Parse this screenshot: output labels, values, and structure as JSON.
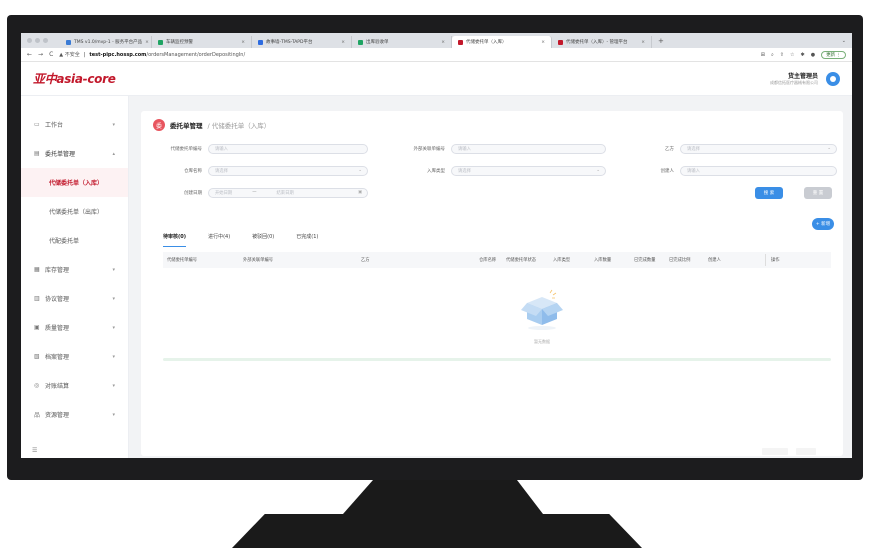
{
  "browser": {
    "tabs": [
      {
        "label": "TMS v1.0/mvp-1 - 服务平台产品",
        "color": "#3a7bd5"
      },
      {
        "label": "车辆监控预警",
        "color": "#1fa463"
      },
      {
        "label": "故事墙-TMS-TAPD平台",
        "color": "#2d6be0"
      },
      {
        "label": "出库验收单",
        "color": "#1fa463"
      },
      {
        "label": "代储委托单（入库）",
        "color": "#c2182b",
        "active": true
      },
      {
        "label": "代储委托单（入库）- 管理平台",
        "color": "#c2182b"
      }
    ],
    "new_tab": "+",
    "more": "⌄",
    "nav": {
      "back": "←",
      "forward": "→",
      "reload": "C"
    },
    "url_warning": "▲ 不安全",
    "url_host": "test-pipc.hossp.com",
    "url_path": "/ordersManagement/orderDepositingIn/",
    "update_label": "更新 ⋮"
  },
  "app": {
    "logo": "亚中asia-core",
    "user_name": "货主管理员",
    "user_org": "成都信拓医疗器械有限公司"
  },
  "sidebar": {
    "items": [
      {
        "icon": "▭",
        "label": "工作台",
        "chev": "▾"
      },
      {
        "icon": "▤",
        "label": "委托单管理",
        "chev": "▴",
        "open": true
      }
    ],
    "sub_items": [
      {
        "label": "代储委托单（入库）",
        "active": true
      },
      {
        "label": "代储委托单（出库）"
      },
      {
        "label": "代配委托单"
      }
    ],
    "more_items": [
      {
        "icon": "▦",
        "label": "库存管理",
        "chev": "▾"
      },
      {
        "icon": "▥",
        "label": "协议管理",
        "chev": "▾"
      },
      {
        "icon": "▣",
        "label": "质量管理",
        "chev": "▾"
      },
      {
        "icon": "▧",
        "label": "档案管理",
        "chev": "▾"
      },
      {
        "icon": "◎",
        "label": "对账结算",
        "chev": "▾"
      },
      {
        "icon": "品",
        "label": "资源管理",
        "chev": "▾"
      }
    ],
    "footer": "☰"
  },
  "page": {
    "badge": "委",
    "title": "委托单管理",
    "crumb": "/ 代储委托单（入库）"
  },
  "filters": {
    "order_no": {
      "label": "代储委托单编号",
      "placeholder": "请输入"
    },
    "external_no": {
      "label": "外部关联单编号",
      "placeholder": "请输入"
    },
    "party_b": {
      "label": "乙方",
      "placeholder": "请选择"
    },
    "warehouse": {
      "label": "仓库名称",
      "placeholder": "请选择"
    },
    "inbound_type": {
      "label": "入库类型",
      "placeholder": "请选择"
    },
    "creator": {
      "label": "创建人",
      "placeholder": "请输入"
    },
    "date_label": "创建日期",
    "date_start": "开始日期",
    "date_sep": "—",
    "date_end": "结束日期",
    "search": "搜 索",
    "reset": "重 置"
  },
  "add_button": "+ 新增",
  "status_tabs": [
    "待审核(0)",
    "进行中(4)",
    "被驳回(0)",
    "已完成(1)"
  ],
  "columns": [
    "代储委托单编号",
    "外部关联单编号",
    "乙方",
    "仓库名称",
    "代储委托单状态",
    "入库类型",
    "入库数量",
    "已完成数量",
    "已完成比例",
    "创建人",
    "操作"
  ],
  "empty_text": "暂无数据",
  "colors": {
    "accent": "#c2182b",
    "primary": "#3a8ee6"
  }
}
